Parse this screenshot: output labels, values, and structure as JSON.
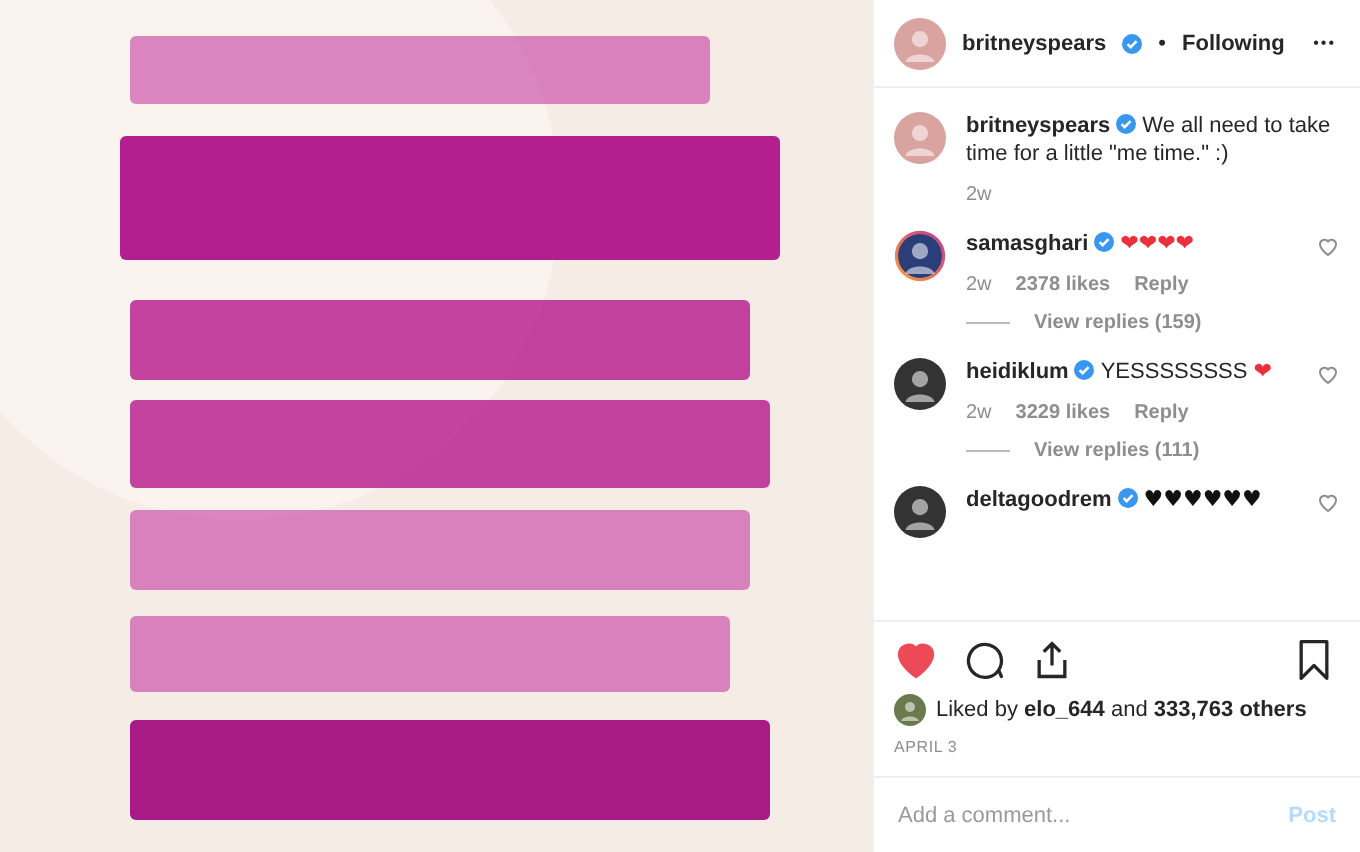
{
  "header": {
    "username": "britneyspears",
    "verified": true,
    "separator": "•",
    "follow_status": "Following",
    "menu": "•••"
  },
  "caption": {
    "username": "britneyspears",
    "verified": true,
    "text_lines": [
      "We all need to take",
      "time for a little \"me time.\" :)"
    ],
    "age": "2w"
  },
  "comments": [
    {
      "username": "samasghari",
      "verified": true,
      "story_ring": true,
      "emoji": "❤❤❤❤",
      "color": "#ed2f3c",
      "age": "2w",
      "likes": "2378 likes",
      "reply": "Reply",
      "view_replies": "View replies (159)"
    },
    {
      "username": "heidiklum",
      "verified": true,
      "story_ring": false,
      "text": "YESSSSSSSS",
      "emoji": "❤",
      "color": "#ed2f3c",
      "age": "2w",
      "likes": "3229 likes",
      "reply": "Reply",
      "view_replies": "View replies (111)"
    },
    {
      "username": "deltagoodrem",
      "verified": true,
      "story_ring": false,
      "emoji": "♥♥♥♥♥♥",
      "color": "#111111"
    }
  ],
  "actions": {
    "liked": true,
    "saved": false
  },
  "likes": {
    "text": "Liked by **elo_644** and **333,763 others**"
  },
  "date": "APRIL 3",
  "comment_field": {
    "placeholder": "Add a comment...",
    "post": "Post",
    "disabled": true
  }
}
